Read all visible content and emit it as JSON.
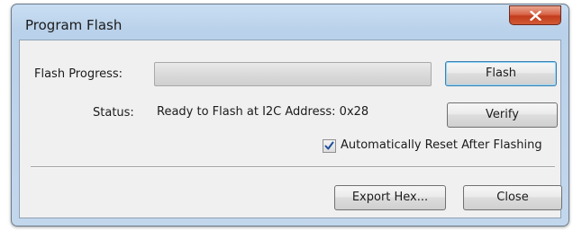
{
  "window": {
    "title": "Program Flash"
  },
  "flash_progress": {
    "label": "Flash Progress:",
    "percent": 0
  },
  "status": {
    "label": "Status:",
    "value": "Ready to Flash at I2C Address: 0x28"
  },
  "buttons": {
    "flash": "Flash",
    "verify": "Verify",
    "export_hex": "Export Hex...",
    "close": "Close"
  },
  "auto_reset": {
    "label": "Automatically Reset After Flashing",
    "checked": true
  },
  "icons": {
    "close": "close-icon",
    "check": "check-icon"
  },
  "colors": {
    "titlebar": "#c3d7ec",
    "close_button": "#c23c1c",
    "default_button_border": "#3c7fb1",
    "client_background": "#f0f0f0"
  }
}
